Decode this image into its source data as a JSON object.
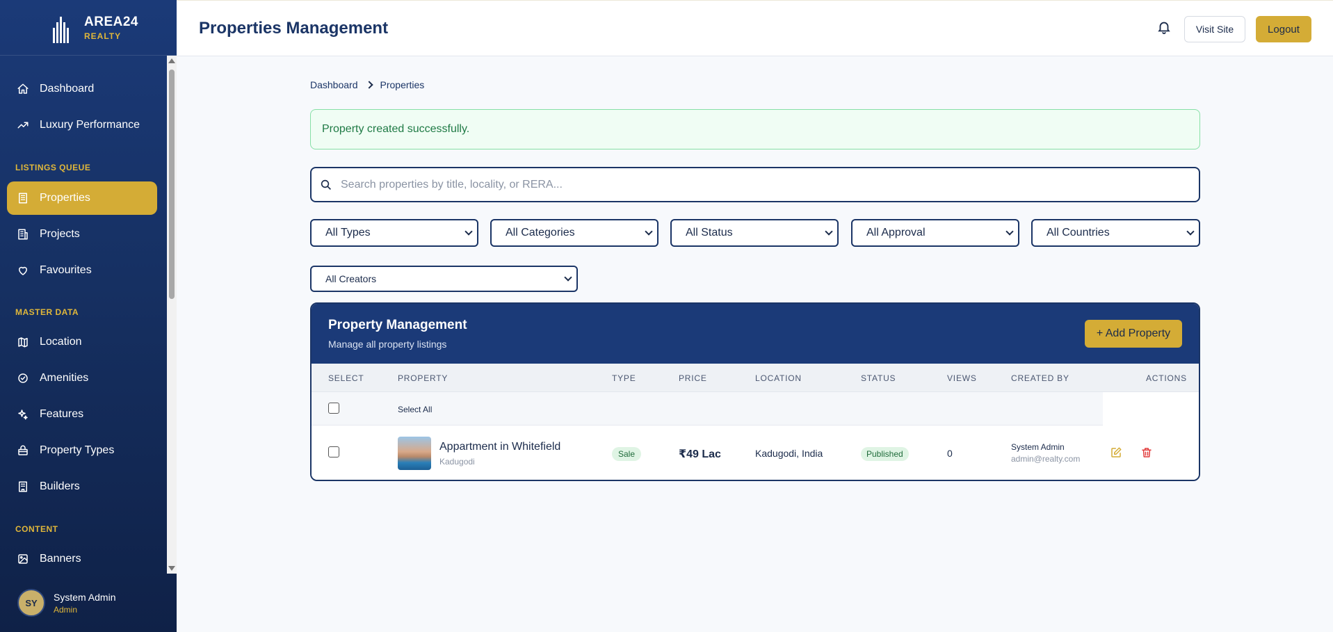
{
  "brand": {
    "name": "AREA24",
    "sub": "REALTY",
    "logo_text": "AREA24"
  },
  "sidebar": {
    "items": [
      {
        "label": "Dashboard",
        "icon": "home-icon"
      },
      {
        "label": "Luxury Performance",
        "icon": "trending-up-icon"
      },
      {
        "label": "Properties",
        "icon": "building-icon",
        "active": true
      },
      {
        "label": "Projects",
        "icon": "office-building-icon"
      },
      {
        "label": "Favourites",
        "icon": "heart-icon"
      },
      {
        "label": "Location",
        "icon": "map-icon"
      },
      {
        "label": "Amenities",
        "icon": "check-circle-icon"
      },
      {
        "label": "Features",
        "icon": "sparkle-icon"
      },
      {
        "label": "Property Types",
        "icon": "lock-icon"
      },
      {
        "label": "Builders",
        "icon": "builder-icon"
      },
      {
        "label": "Banners",
        "icon": "image-icon"
      }
    ],
    "sections": [
      "LISTINGS QUEUE",
      "MASTER DATA",
      "CONTENT"
    ]
  },
  "user": {
    "initials": "SY",
    "name": "System Admin",
    "role": "Admin"
  },
  "header": {
    "title": "Properties Management",
    "visit_label": "Visit Site",
    "logout_label": "Logout"
  },
  "breadcrumb": {
    "home": "Dashboard",
    "current": "Properties"
  },
  "alert": {
    "message": "Property created successfully."
  },
  "search": {
    "placeholder": "Search properties by title, locality, or RERA..."
  },
  "filters": {
    "types": "All Types",
    "categories": "All Categories",
    "status": "All Status",
    "approval": "All Approval",
    "countries": "All Countries",
    "creators": "All Creators"
  },
  "table": {
    "title": "Property Management",
    "subtitle": "Manage all property listings",
    "add_label": "+ Add Property",
    "headers": [
      "SELECT",
      "PROPERTY",
      "TYPE",
      "PRICE",
      "LOCATION",
      "STATUS",
      "VIEWS",
      "CREATED BY",
      "ACTIONS"
    ],
    "select_all_label": "Select All",
    "rows": [
      {
        "name": "Appartment in Whitefield",
        "locality": "Kadugodi",
        "type": "Sale",
        "price": "₹49 Lac",
        "location": "Kadugodi, India",
        "status": "Published",
        "views": "0",
        "creator_name": "System Admin",
        "creator_email": "admin@realty.com"
      }
    ]
  },
  "colors": {
    "navy": "#1b3a78",
    "gold": "#d4ac36",
    "success_bg": "#f0fdf4",
    "danger": "#e23b3b"
  }
}
